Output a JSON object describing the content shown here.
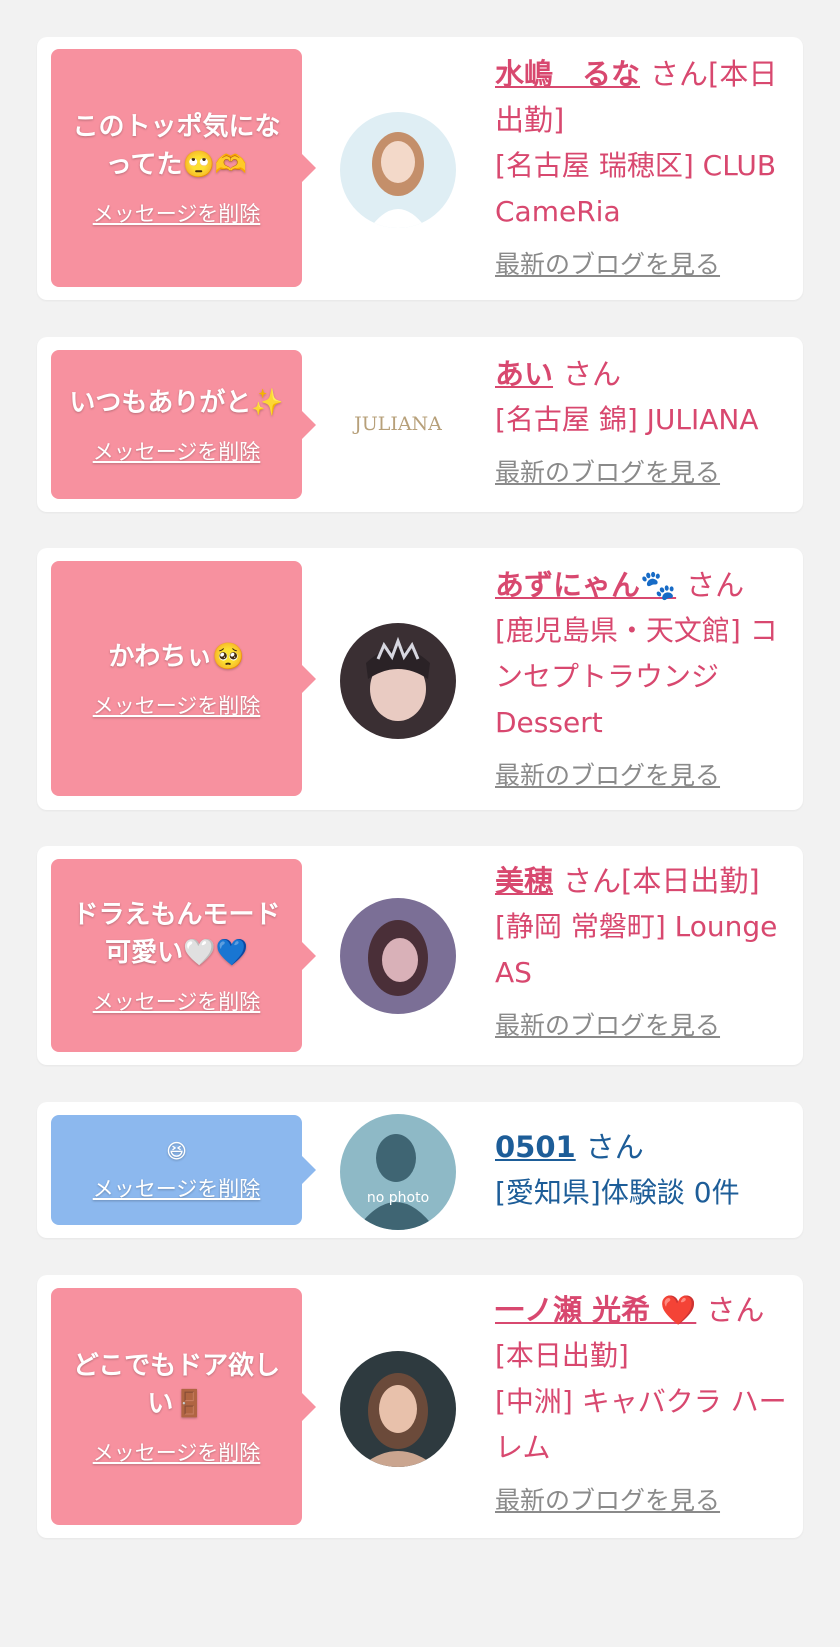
{
  "delete_label": "メッセージを削除",
  "blog_label": "最新のブログを見る",
  "cards": [
    {
      "message": "このトッポ気になってた🙄🫶",
      "name": "水嶋　るな",
      "suffix": "さん[本日出勤]",
      "shop": "[名古屋 瑞穂区] CLUB CameRia"
    },
    {
      "message": "いつもありがと✨",
      "avatar_text": "JULIANA",
      "name": "あい",
      "suffix": "さん",
      "shop": "[名古屋 錦] JULIANA"
    },
    {
      "message": "かわちぃ🥺",
      "name": "あずにゃん🐾",
      "suffix": "さん",
      "shop": "[鹿児島県・天文館] コンセプトラウンジDessert"
    },
    {
      "message": "ドラえもんモード可愛い🤍💙",
      "name": "美穂",
      "suffix": "さん[本日出勤]",
      "shop": "[静岡 常磐町] Lounge AS"
    },
    {
      "message": "😆",
      "avatar_text": "no photo",
      "name": "0501",
      "suffix": "さん",
      "shop": "[愛知県]体験談 0件"
    },
    {
      "message": "どこでもドア欲しい🚪",
      "name": "一ノ瀬 光希 ❤️",
      "suffix": "さん",
      "shop_line1": "[本日出勤]",
      "shop": "[中洲] キャバクラ ハーレム"
    }
  ],
  "colors": {
    "pink_bubble": "#f7919f",
    "blue_bubble": "#8cb8ee",
    "name_pink": "#d8486f",
    "name_blue": "#1d5d98",
    "background": "#f2f2f2"
  }
}
